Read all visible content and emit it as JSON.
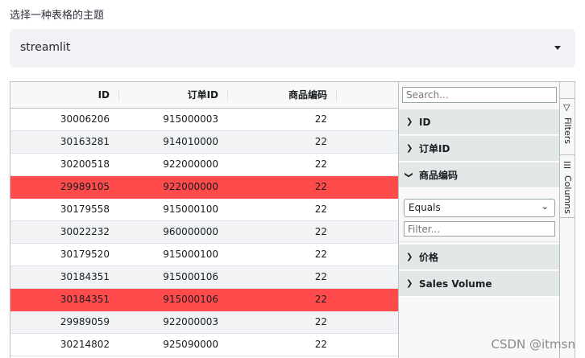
{
  "prompt": {
    "label": "选择一种表格的主题"
  },
  "theme_select": {
    "value": "streamlit"
  },
  "grid": {
    "columns": [
      "ID",
      "订单ID",
      "商品编码"
    ],
    "rows": [
      {
        "id": "30006206",
        "order_id": "915000003",
        "code": "22",
        "highlight": false
      },
      {
        "id": "30163281",
        "order_id": "914010000",
        "code": "22",
        "highlight": false
      },
      {
        "id": "30200518",
        "order_id": "922000000",
        "code": "22",
        "highlight": false
      },
      {
        "id": "29989105",
        "order_id": "922000000",
        "code": "22",
        "highlight": true
      },
      {
        "id": "30179558",
        "order_id": "915000100",
        "code": "22",
        "highlight": false
      },
      {
        "id": "30022232",
        "order_id": "960000000",
        "code": "22",
        "highlight": false
      },
      {
        "id": "30179520",
        "order_id": "915000100",
        "code": "22",
        "highlight": false
      },
      {
        "id": "30184351",
        "order_id": "915000106",
        "code": "22",
        "highlight": false
      },
      {
        "id": "30184351",
        "order_id": "915000106",
        "code": "22",
        "highlight": true
      },
      {
        "id": "29989059",
        "order_id": "922000003",
        "code": "22",
        "highlight": false
      },
      {
        "id": "30214802",
        "order_id": "925090000",
        "code": "22",
        "highlight": false
      }
    ],
    "highlight_color": "#ff4b4b"
  },
  "filter_panel": {
    "search_placeholder": "Search...",
    "groups": [
      {
        "label": "ID",
        "expanded": false
      },
      {
        "label": "订单ID",
        "expanded": false
      },
      {
        "label": "商品编码",
        "expanded": true
      },
      {
        "label": "价格",
        "expanded": false
      },
      {
        "label": "Sales Volume",
        "expanded": false
      }
    ],
    "operator": "Equals",
    "filter_placeholder": "Filter..."
  },
  "side_bar": {
    "filters_label": "Filters",
    "columns_label": "Columns"
  },
  "watermark": "CSDN @itmsn"
}
